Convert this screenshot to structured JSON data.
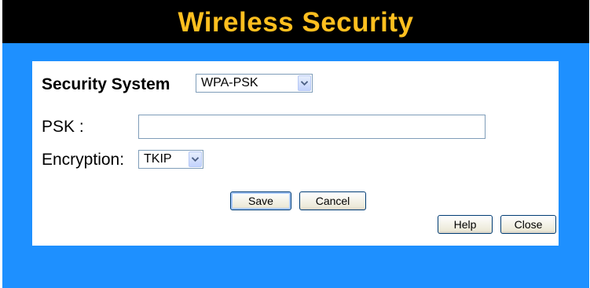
{
  "header": {
    "title": "Wireless Security"
  },
  "form": {
    "security_label": "Security System",
    "security_value": "WPA-PSK",
    "psk_label": "PSK :",
    "psk_value": "",
    "encryption_label": "Encryption:",
    "encryption_value": "TKIP"
  },
  "buttons": {
    "save": "Save",
    "cancel": "Cancel",
    "help": "Help",
    "close": "Close"
  },
  "colors": {
    "background": "#1e90ff",
    "title_bar": "#000000",
    "title_text": "#ffbf1f",
    "panel": "#ffffff"
  }
}
